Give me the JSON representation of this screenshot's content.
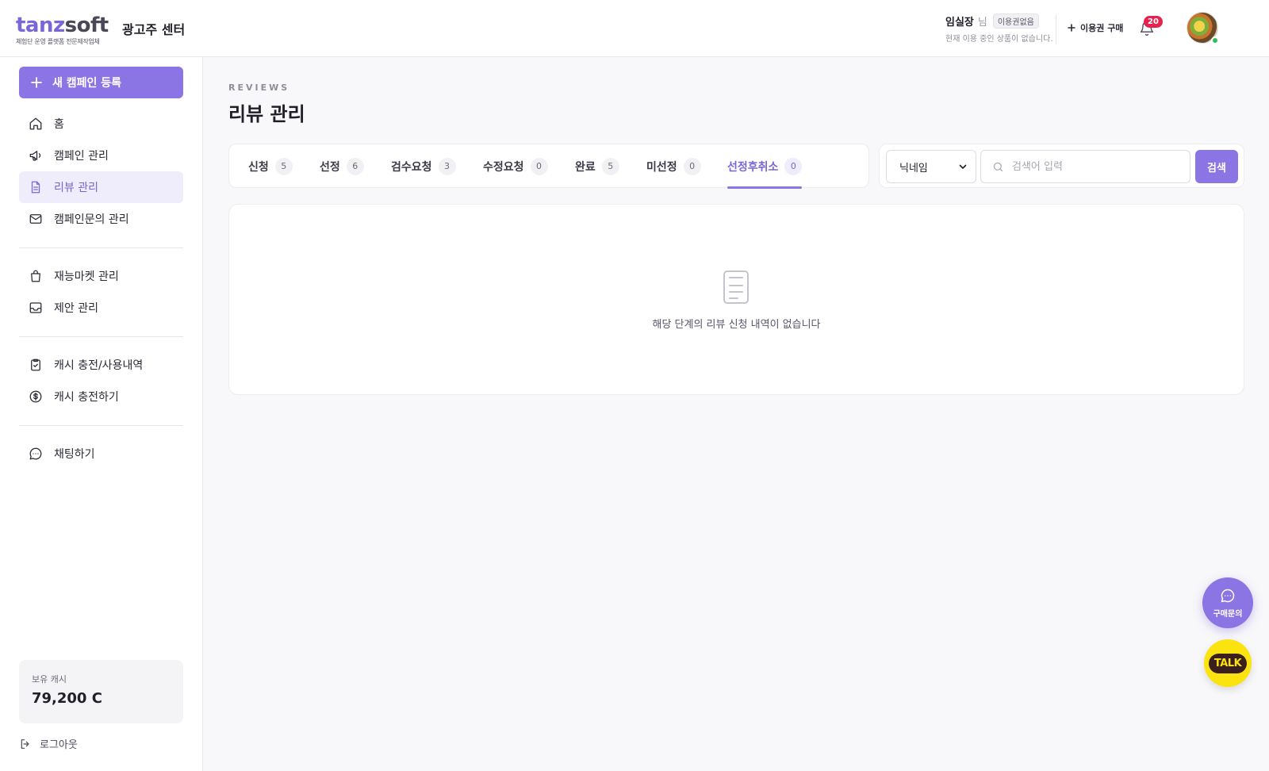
{
  "header": {
    "logo_part1": "tanz",
    "logo_part2": "soft",
    "logo_tagline": "체험단 운영 플랫폼 전문제작업체",
    "center_title": "광고주 센터",
    "user_name": "임실장",
    "user_suffix": "님",
    "plan_badge": "이용권없음",
    "plan_status": "현재 이용 중인 상품이 없습니다.",
    "buy_label": "이용권 구매",
    "notification_count": "20"
  },
  "sidebar": {
    "new_campaign_label": "새 캠페인 등록",
    "group1": [
      {
        "label": "홈",
        "icon": "home-icon"
      },
      {
        "label": "캠페인 관리",
        "icon": "megaphone-icon"
      },
      {
        "label": "리뷰 관리",
        "icon": "document-icon",
        "active": true
      },
      {
        "label": "캠페인문의 관리",
        "icon": "mail-icon"
      }
    ],
    "group2": [
      {
        "label": "재능마켓 관리",
        "icon": "shopping-bag-icon"
      },
      {
        "label": "제안 관리",
        "icon": "inbox-icon"
      }
    ],
    "group3": [
      {
        "label": "캐시 충전/사용내역",
        "icon": "clipboard-check-icon"
      },
      {
        "label": "캐시 충전하기",
        "icon": "dollar-circle-icon"
      }
    ],
    "group4": [
      {
        "label": "채팅하기",
        "icon": "chat-icon"
      }
    ],
    "cash_label": "보유 캐시",
    "cash_value": "79,200 C",
    "logout_label": "로그아웃"
  },
  "main": {
    "eyebrow": "REVIEWS",
    "title": "리뷰 관리",
    "tabs": [
      {
        "label": "신청",
        "count": "5"
      },
      {
        "label": "선정",
        "count": "6"
      },
      {
        "label": "검수요청",
        "count": "3"
      },
      {
        "label": "수정요청",
        "count": "0"
      },
      {
        "label": "완료",
        "count": "5"
      },
      {
        "label": "미선정",
        "count": "0"
      },
      {
        "label": "선정후취소",
        "count": "0",
        "active": true
      }
    ],
    "search": {
      "select_value": "닉네임",
      "placeholder": "검색어 입력",
      "value": "",
      "button_label": "검색"
    },
    "empty_message": "해당 단계의 리뷰 신청 내역이 없습니다"
  },
  "floating": {
    "inquiry_label": "구매문의",
    "talk_label": "TALK"
  },
  "colors": {
    "accent": "#8b74e4",
    "accent_light": "#efedfc",
    "badge_red": "#e5224e",
    "kakao_yellow": "#fbe30f"
  }
}
